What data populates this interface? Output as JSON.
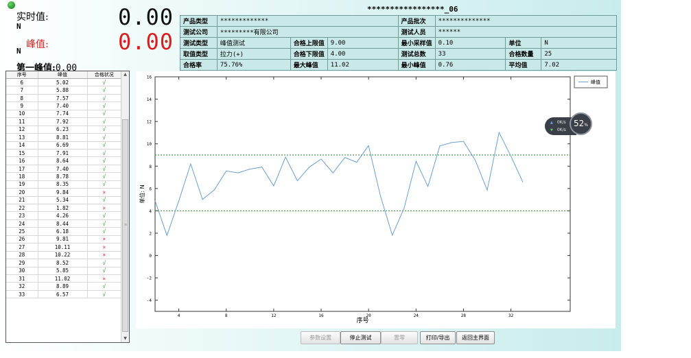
{
  "readouts": {
    "realtime_label": "实时值:",
    "realtime_unit": "N",
    "realtime_value": "0.00",
    "peak_label": "峰值:",
    "peak_unit": "N",
    "peak_value": "0.00",
    "first_peak_label": "第一峰值:",
    "first_peak_value": "0.00"
  },
  "colors": {
    "realtime": "#111111",
    "peak": "#d81e1e",
    "line": "#6a9fd0",
    "limit": "#2a8a2a"
  },
  "batch_title": "*****************_06",
  "info": {
    "product_type_label": "产品类型",
    "product_type": "*************",
    "product_batch_label": "产品批次",
    "product_batch": "**************",
    "company_label": "测试公司",
    "company": "*********有限公司",
    "tester_label": "测试人员",
    "tester": "******",
    "test_type_label": "测试类型",
    "test_type": "峰值测试",
    "upper_limit_label": "合格上限值",
    "upper_limit": "9.00",
    "min_sample_label": "最小采样值",
    "min_sample": "0.10",
    "unit_label": "单位",
    "unit": "N",
    "value_type_label": "取值类型",
    "value_type": "拉力(+)",
    "lower_limit_label": "合格下限值",
    "lower_limit": "4.00",
    "total_label": "测试总数",
    "total": "33",
    "pass_count_label": "合格数量",
    "pass_count": "25",
    "pass_rate_label": "合格率",
    "pass_rate": "75.76%",
    "max_peak_label": "最大峰值",
    "max_peak": "11.02",
    "min_peak_label": "最小峰值",
    "min_peak": "0.76",
    "avg_label": "平均值",
    "avg": "7.02"
  },
  "list": {
    "headers": [
      "序号",
      "峰值",
      "合格状况"
    ],
    "rows": [
      [
        "6",
        "5.02",
        "pass"
      ],
      [
        "7",
        "5.88",
        "pass"
      ],
      [
        "8",
        "7.57",
        "pass"
      ],
      [
        "9",
        "7.40",
        "pass"
      ],
      [
        "10",
        "7.74",
        "pass"
      ],
      [
        "11",
        "7.92",
        "pass"
      ],
      [
        "12",
        "6.23",
        "pass"
      ],
      [
        "13",
        "8.81",
        "pass"
      ],
      [
        "14",
        "6.69",
        "pass"
      ],
      [
        "15",
        "7.91",
        "pass"
      ],
      [
        "16",
        "8.64",
        "pass"
      ],
      [
        "17",
        "7.40",
        "pass"
      ],
      [
        "18",
        "8.78",
        "pass"
      ],
      [
        "19",
        "8.35",
        "pass"
      ],
      [
        "20",
        "9.84",
        "fail"
      ],
      [
        "21",
        "5.34",
        "pass"
      ],
      [
        "22",
        "1.82",
        "fail"
      ],
      [
        "23",
        "4.26",
        "pass"
      ],
      [
        "24",
        "8.44",
        "pass"
      ],
      [
        "25",
        "6.18",
        "pass"
      ],
      [
        "26",
        "9.81",
        "fail"
      ],
      [
        "27",
        "10.11",
        "fail"
      ],
      [
        "28",
        "10.22",
        "fail"
      ],
      [
        "29",
        "8.52",
        "pass"
      ],
      [
        "30",
        "5.85",
        "pass"
      ],
      [
        "31",
        "11.02",
        "fail"
      ],
      [
        "32",
        "8.89",
        "pass"
      ],
      [
        "33",
        "6.57",
        "pass"
      ]
    ],
    "pass_glyph": "√",
    "fail_glyph": "×"
  },
  "chart_data": {
    "type": "line",
    "xlabel": "序号",
    "ylabel": "单位: N",
    "xlim": [
      2,
      37
    ],
    "ylim": [
      -5,
      16
    ],
    "xticks": [
      4,
      8,
      12,
      16,
      20,
      24,
      28,
      32
    ],
    "yticks": [
      -4,
      -2,
      0,
      2,
      4,
      6,
      8,
      10,
      12,
      14,
      16
    ],
    "legend_position": "top-right",
    "upper_limit": 9.0,
    "lower_limit": 4.0,
    "series": [
      {
        "name": "峰值",
        "x": [
          2,
          3,
          4,
          5,
          6,
          7,
          8,
          9,
          10,
          11,
          12,
          13,
          14,
          15,
          16,
          17,
          18,
          19,
          20,
          21,
          22,
          23,
          24,
          25,
          26,
          27,
          28,
          29,
          30,
          31,
          32,
          33
        ],
        "values": [
          4.9,
          1.8,
          4.9,
          8.2,
          5.02,
          5.88,
          7.57,
          7.4,
          7.74,
          7.92,
          6.23,
          8.81,
          6.69,
          7.91,
          8.64,
          7.4,
          8.78,
          8.35,
          9.84,
          5.34,
          1.82,
          4.26,
          8.44,
          6.18,
          9.81,
          10.11,
          10.22,
          8.52,
          5.85,
          11.02,
          8.89,
          6.57
        ]
      }
    ]
  },
  "speed_widget": {
    "up": "0K/s",
    "down": "0K/s",
    "percent": "52",
    "percent_unit": "%"
  },
  "buttons": {
    "param": "参数设置",
    "stop": "停止测试",
    "zero": "置零",
    "print": "打印/导出",
    "back": "返回主界面"
  }
}
